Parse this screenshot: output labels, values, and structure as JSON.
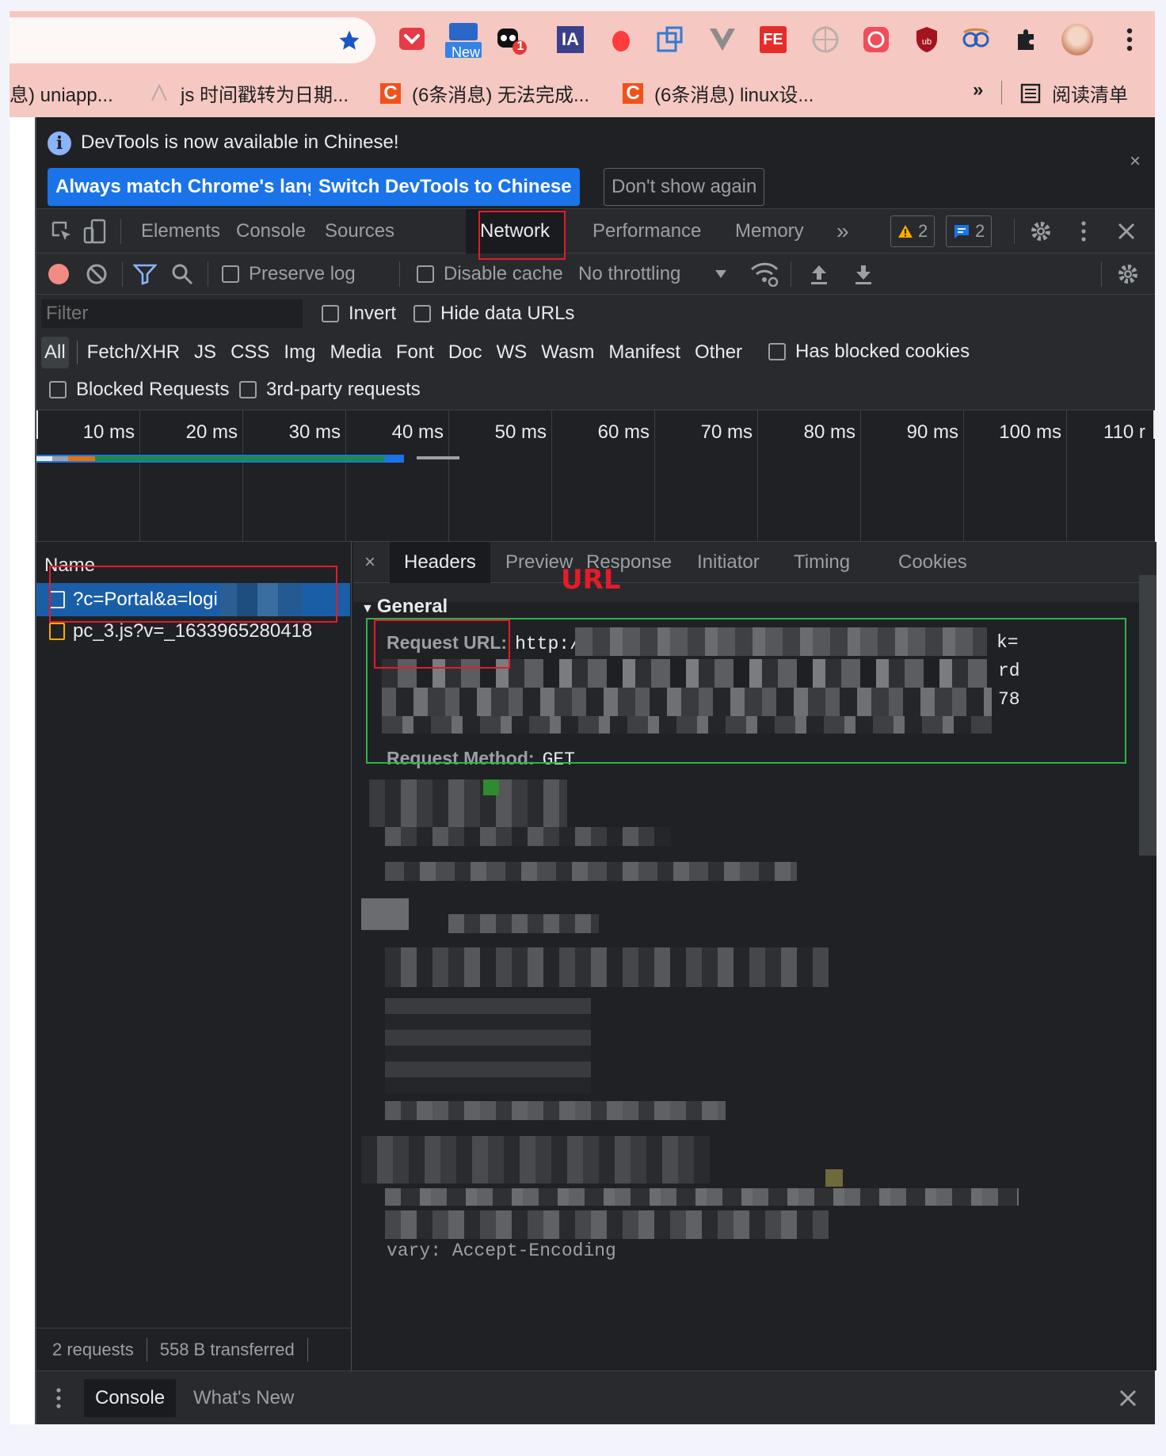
{
  "bookmarks": [
    {
      "label": "息) uniapp..."
    },
    {
      "label": "js 时间戳转为日期..."
    },
    {
      "label": "(6条消息) 无法完成..."
    },
    {
      "label": "(6条消息) linux设..."
    }
  ],
  "bookmarks_more": "»",
  "reading_list": "阅读清单",
  "extensions": {
    "new_label": "New",
    "notify_count": "1",
    "ia_label": "IA",
    "fe_label": "FE"
  },
  "infobar": {
    "message": "DevTools is now available in Chinese!",
    "buttons": [
      "Always match Chrome's language",
      "Switch DevTools to Chinese",
      "Don't show again"
    ],
    "close": "×"
  },
  "tabs": [
    "Elements",
    "Console",
    "Sources",
    "Network",
    "Performance",
    "Memory"
  ],
  "active_tab": "Network",
  "more_tabs": "»",
  "warnings_count": "2",
  "messages_count": "2",
  "toolbar": {
    "preserve_log": "Preserve log",
    "disable_cache": "Disable cache",
    "throttling": "No throttling"
  },
  "filter": {
    "placeholder": "Filter",
    "invert": "Invert",
    "hide_data_urls": "Hide data URLs",
    "types": [
      "All",
      "Fetch/XHR",
      "JS",
      "CSS",
      "Img",
      "Media",
      "Font",
      "Doc",
      "WS",
      "Wasm",
      "Manifest",
      "Other"
    ],
    "has_blocked_cookies": "Has blocked cookies",
    "blocked_requests": "Blocked Requests",
    "third_party": "3rd-party requests"
  },
  "timeline_ticks": [
    "10 ms",
    "20 ms",
    "30 ms",
    "40 ms",
    "50 ms",
    "60 ms",
    "70 ms",
    "80 ms",
    "90 ms",
    "100 ms",
    "110 r"
  ],
  "requests": {
    "header": "Name",
    "rows": [
      {
        "name": "?c=Portal&a=logi"
      },
      {
        "name": "pc_3.js?v=_1633965280418"
      }
    ],
    "status": {
      "count": "2 requests",
      "transferred": "558 B transferred"
    }
  },
  "details": {
    "close": "×",
    "tabs": [
      "Headers",
      "Preview",
      "Response",
      "Initiator",
      "Timing",
      "Cookies"
    ],
    "active_tab": "Headers",
    "section": "General",
    "request_url_key": "Request URL:",
    "request_url_value": "http://10",
    "request_method_key": "Request Method:",
    "request_method_value": "GET",
    "vary_row": "vary: Accept-Encoding",
    "url_fragments": [
      "k=",
      "rd",
      "78"
    ]
  },
  "annotation_label": "URL",
  "drawer": {
    "tabs": [
      "Console",
      "What's New"
    ],
    "active": "Console",
    "close": "×"
  },
  "colors": {
    "accent_blue": "#1a73e8",
    "annotation_red": "#e51b2a",
    "annotation_green": "#2fb34a",
    "chrome_frame": "#f5c8c1",
    "devtools_bg": "#202124"
  }
}
